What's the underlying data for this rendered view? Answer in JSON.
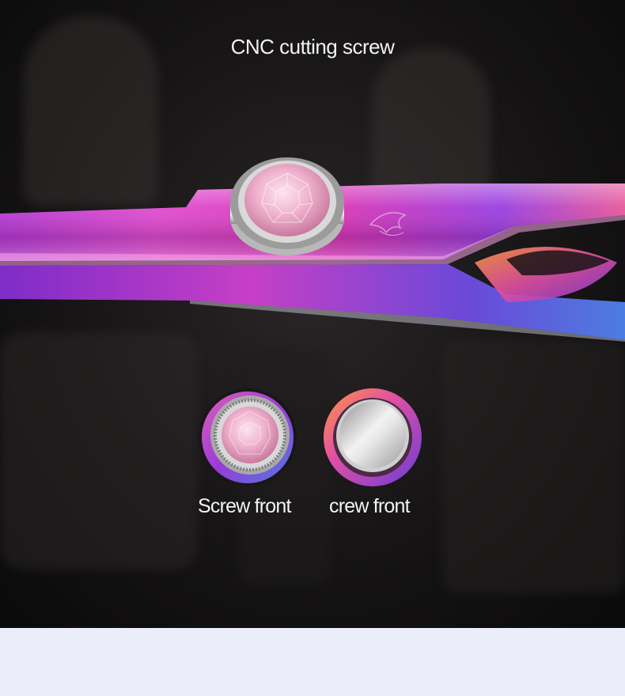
{
  "title": "CNC cutting screw",
  "captions": {
    "screw_front_left": "Screw front",
    "screw_front_right": "crew front"
  },
  "colors": {
    "background_dark": "#141213",
    "blade_pink": "#e23fc4",
    "blade_purple": "#8a3be0",
    "gem_pink": "#f2b6d0",
    "footer_band": "#ecedfb",
    "text": "#f2f2f2"
  },
  "icons": {
    "main_screw": "crystal-screw-icon",
    "thumb_left": "crystal-screw-icon",
    "thumb_right": "flat-screw-icon",
    "blade_logo": "phoenix-logo-icon"
  }
}
